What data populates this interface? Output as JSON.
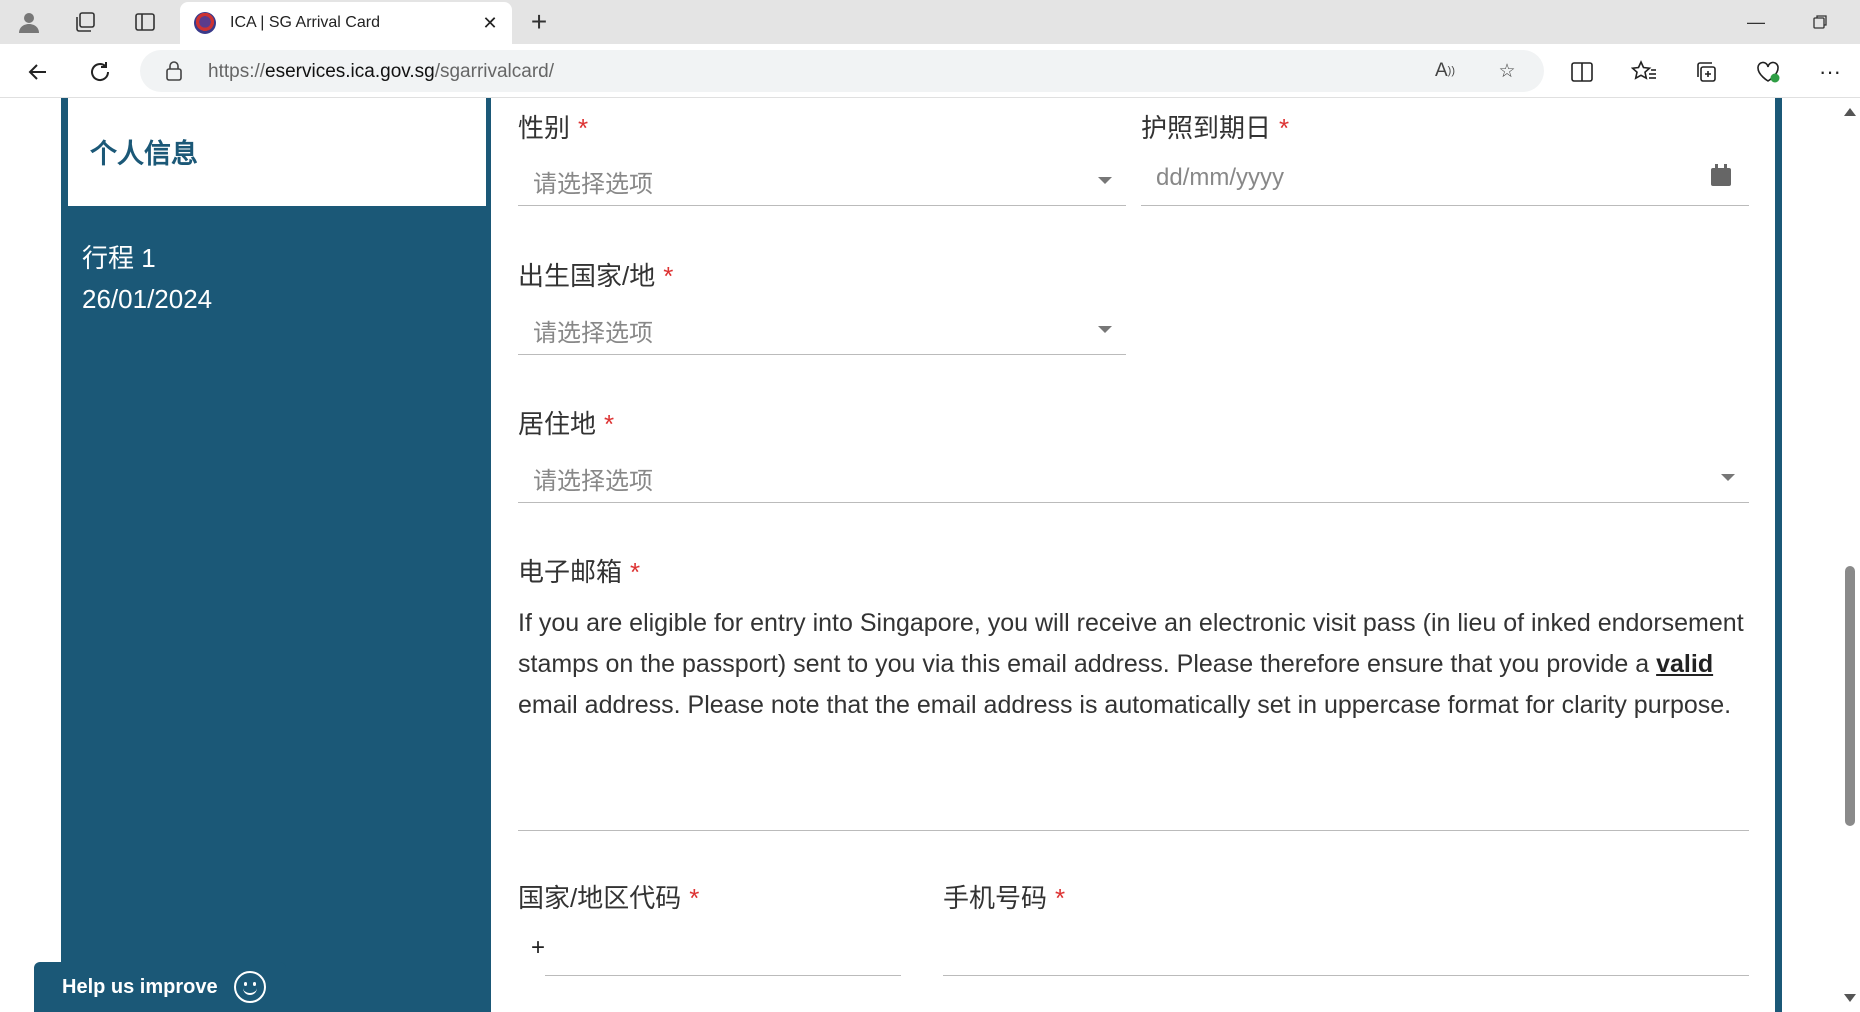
{
  "browser": {
    "tab_title": "ICA | SG Arrival Card",
    "url_prefix": "https://",
    "url_domain": "eservices.ica.gov.sg",
    "url_path": "/sgarrivalcard/",
    "icons": {
      "profile": "profile-icon",
      "workspaces": "workspaces-icon",
      "tab_actions": "tab-actions-icon",
      "close_tab": "close-icon",
      "new_tab": "plus-icon",
      "back": "back-arrow-icon",
      "refresh": "refresh-icon",
      "lock": "lock-icon",
      "read_aloud": "read-aloud-icon",
      "favorite": "star-icon",
      "split_screen": "split-screen-icon",
      "favorites": "favorites-icon",
      "collections": "collections-icon",
      "health": "browser-essentials-icon",
      "more": "more-icon"
    }
  },
  "sidebar": {
    "active_item": "个人信息",
    "trip_label": "行程 1",
    "trip_date": "26/01/2024"
  },
  "form": {
    "gender": {
      "label": "性别",
      "required": "*",
      "placeholder": "请选择选项"
    },
    "passport_expiry": {
      "label": "护照到期日",
      "required": "*",
      "placeholder": "dd/mm/yyyy"
    },
    "birth_country": {
      "label": "出生国家/地",
      "required": "*",
      "placeholder": "请选择选项"
    },
    "residence": {
      "label": "居住地",
      "required": "*",
      "placeholder": "请选择选项"
    },
    "email": {
      "label": "电子邮箱",
      "required": "*",
      "desc_before": "If you are eligible for entry into Singapore, you will receive an electronic visit pass (in lieu of inked endorsement stamps on the passport) sent to you via this email address. Please therefore ensure that you provide a ",
      "desc_link": "valid",
      "desc_after": " email address. Please note that the email address is automatically set in uppercase format for clarity purpose."
    },
    "country_code": {
      "label": "国家/地区代码",
      "required": "*",
      "prefix": "+"
    },
    "mobile": {
      "label": "手机号码",
      "required": "*"
    }
  },
  "help_button": {
    "label": "Help us improve"
  },
  "colors": {
    "brand": "#1b5877",
    "required": "#dd3333"
  }
}
